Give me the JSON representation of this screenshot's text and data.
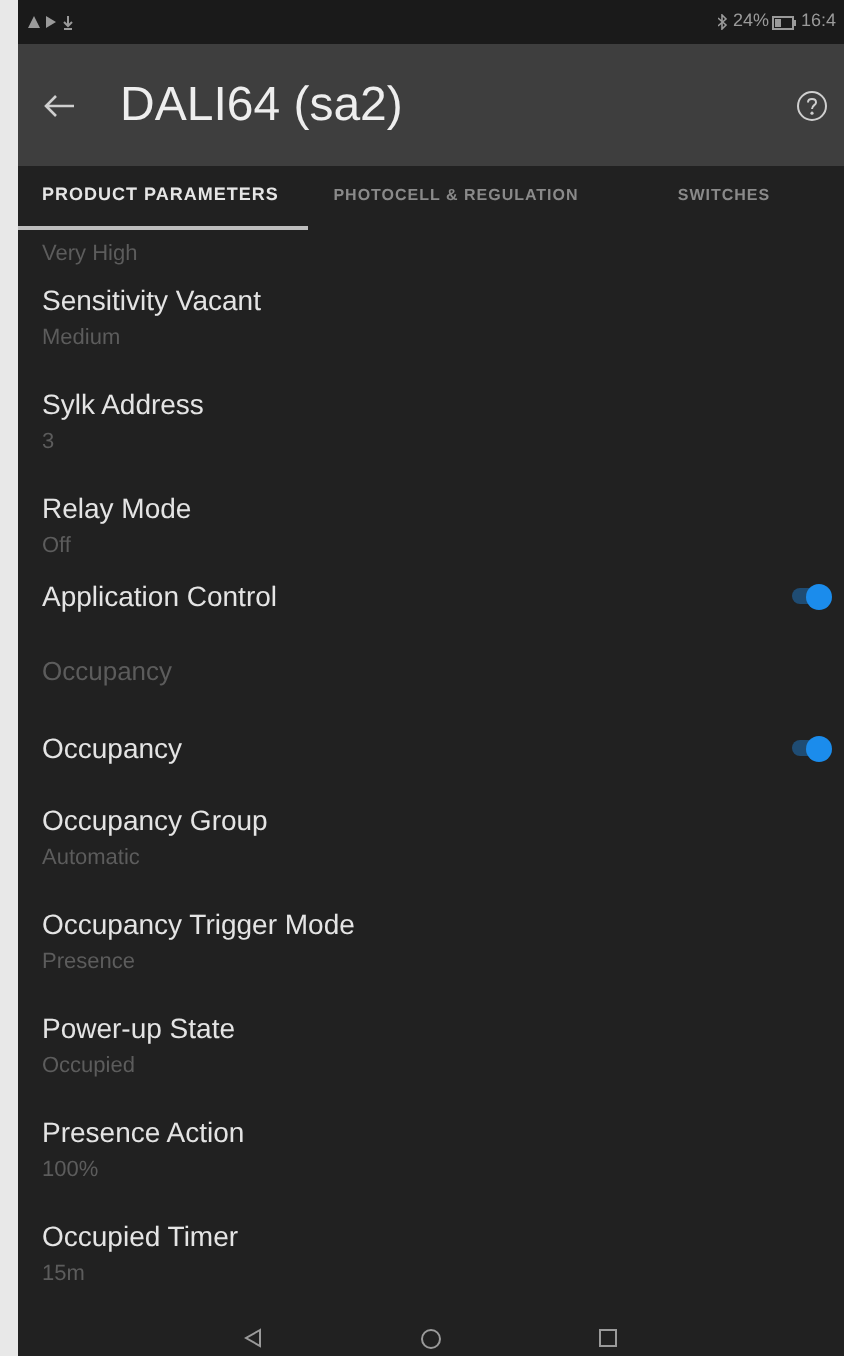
{
  "status_bar": {
    "battery": "24%",
    "time": "16:4"
  },
  "header": {
    "title": "DALI64 (sa2)"
  },
  "tabs": [
    {
      "label": "PRODUCT PARAMETERS",
      "selected": true
    },
    {
      "label": "PHOTOCELL & REGULATION",
      "selected": false
    },
    {
      "label": "SWITCHES",
      "selected": false
    }
  ],
  "rows": [
    {
      "kind": "value_only",
      "value": "Very High"
    },
    {
      "kind": "setting",
      "title": "Sensitivity Vacant",
      "value": "Medium"
    },
    {
      "kind": "setting",
      "title": "Sylk Address",
      "value": "3"
    },
    {
      "kind": "setting",
      "title": "Relay Mode",
      "value": "Off"
    },
    {
      "kind": "toggle",
      "title": "Application Control",
      "on": true
    },
    {
      "kind": "section",
      "title": "Occupancy"
    },
    {
      "kind": "toggle",
      "title": "Occupancy",
      "on": true
    },
    {
      "kind": "setting",
      "title": "Occupancy Group",
      "value": "Automatic"
    },
    {
      "kind": "setting",
      "title": "Occupancy Trigger Mode",
      "value": "Presence"
    },
    {
      "kind": "setting",
      "title": "Power-up State",
      "value": "Occupied"
    },
    {
      "kind": "setting",
      "title": "Presence Action",
      "value": "100%"
    },
    {
      "kind": "setting",
      "title": "Occupied Timer",
      "value": "15m"
    }
  ]
}
